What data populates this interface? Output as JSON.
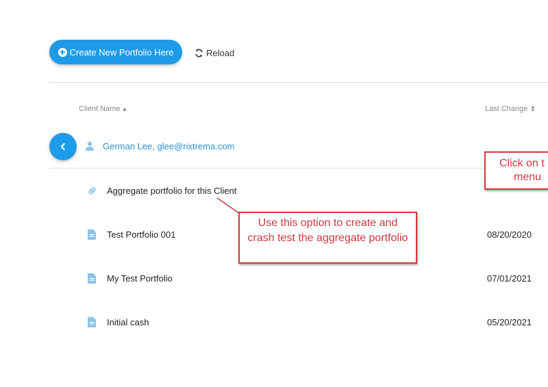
{
  "toolbar": {
    "create_label": "Create New Portfolio Here",
    "reload_label": "Reload"
  },
  "table": {
    "columns": [
      {
        "label": "Client Name",
        "sort": "ascending"
      },
      {
        "label": "Last Change",
        "sort": "unsorted"
      }
    ]
  },
  "client": {
    "name": "German Lee, glee@rixtrema.com",
    "icon": "user-icon"
  },
  "portfolios": [
    {
      "name": "Aggregate portfolio for this Client",
      "date": "",
      "icon": "link-icon"
    },
    {
      "name": "Test Portfolio 001",
      "date": "08/20/2020",
      "icon": "document-icon"
    },
    {
      "name": "My Test Portfolio",
      "date": "07/01/2021",
      "icon": "document-icon"
    },
    {
      "name": "Initial cash",
      "date": "05/20/2021",
      "icon": "document-icon"
    }
  ],
  "annotations": {
    "main": "Use this option to create and crash test the aggregate portfolio",
    "right_line1": "Click on t",
    "right_line2": "menu"
  },
  "colors": {
    "accent": "#1e9be8",
    "link": "#2d8fcf",
    "callout": "#d0383b",
    "icon": "#8cc3e8"
  }
}
